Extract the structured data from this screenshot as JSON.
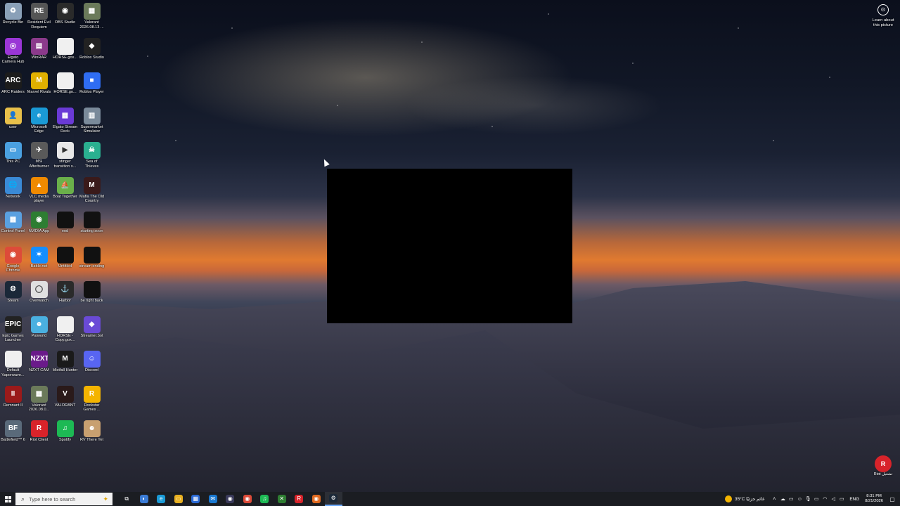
{
  "desktop": {
    "icons": [
      {
        "label": "Recycle Bin",
        "icon": "recycle-bin-icon",
        "color": "#8aa0b8",
        "glyph": "♻"
      },
      {
        "label": "Resident Evil Requiem",
        "icon": "resident-evil-icon",
        "color": "#555555",
        "glyph": "RE"
      },
      {
        "label": "OBS Studio",
        "icon": "obs-studio-icon",
        "color": "#2a2a2a",
        "glyph": "◉"
      },
      {
        "label": "Valorant 2026.08.13 ...",
        "icon": "valorant-clip-icon",
        "color": "#6b7a5a",
        "glyph": "▦"
      },
      {
        "label": "Elgato Camera Hub",
        "icon": "elgato-camera-hub-icon",
        "color": "#9a36d6",
        "glyph": "◎"
      },
      {
        "label": "WinRAR",
        "icon": "winrar-icon",
        "color": "#8b3a8b",
        "glyph": "▤"
      },
      {
        "label": "HORSE.gox...",
        "icon": "file-icon",
        "color": "#f0f0f0",
        "glyph": ""
      },
      {
        "label": "Roblox Studio",
        "icon": "roblox-studio-icon",
        "color": "#222222",
        "glyph": "◆"
      },
      {
        "label": "ARC Raiders",
        "icon": "arc-raiders-icon",
        "color": "#1c1c1c",
        "glyph": "ARC"
      },
      {
        "label": "Marvel Rivals",
        "icon": "marvel-rivals-icon",
        "color": "#e0b000",
        "glyph": "M"
      },
      {
        "label": "HORSE.go...",
        "icon": "file-icon",
        "color": "#f0f0f0",
        "glyph": ""
      },
      {
        "label": "Roblox Player",
        "icon": "roblox-player-icon",
        "color": "#2f6df2",
        "glyph": "■"
      },
      {
        "label": "user",
        "icon": "user-folder-icon",
        "color": "#e8c04a",
        "glyph": "👤"
      },
      {
        "label": "Microsoft Edge",
        "icon": "microsoft-edge-icon",
        "color": "#1a9ad6",
        "glyph": "e"
      },
      {
        "label": "Elgato Stream Deck",
        "icon": "elgato-stream-deck-icon",
        "color": "#6a3ad6",
        "glyph": "▦"
      },
      {
        "label": "Supermarket Simulator",
        "icon": "supermarket-simulator-icon",
        "color": "#7a8a9a",
        "glyph": "▥"
      },
      {
        "label": "This PC",
        "icon": "this-pc-icon",
        "color": "#4aa0e0",
        "glyph": "▭"
      },
      {
        "label": "MSI Afterburner",
        "icon": "msi-afterburner-icon",
        "color": "#5a5a5a",
        "glyph": "✈"
      },
      {
        "label": "stinger transition s...",
        "icon": "file-icon",
        "color": "#e8e8e8",
        "glyph": "▶"
      },
      {
        "label": "Sea of Thieves",
        "icon": "sea-of-thieves-icon",
        "color": "#2ab090",
        "glyph": "☠"
      },
      {
        "label": "Network",
        "icon": "network-icon",
        "color": "#3a8ad6",
        "glyph": "🌐"
      },
      {
        "label": "VLC media player",
        "icon": "vlc-icon",
        "color": "#f08a00",
        "glyph": "▲"
      },
      {
        "label": "Boat Together",
        "icon": "boat-together-icon",
        "color": "#6ab04a",
        "glyph": "⛵"
      },
      {
        "label": "Mafia The Old Country",
        "icon": "mafia-icon",
        "color": "#3a1a1a",
        "glyph": "M"
      },
      {
        "label": "Control Panel",
        "icon": "control-panel-icon",
        "color": "#5aa0e0",
        "glyph": "▦"
      },
      {
        "label": "NVIDIA App",
        "icon": "nvidia-app-icon",
        "color": "#2e7d32",
        "glyph": "◉"
      },
      {
        "label": "end",
        "icon": "video-file-icon",
        "color": "#111111",
        "glyph": ""
      },
      {
        "label": "starting soon",
        "icon": "video-file-icon",
        "color": "#111111",
        "glyph": ""
      },
      {
        "label": "Google Chrome",
        "icon": "google-chrome-icon",
        "color": "#dd4b39",
        "glyph": "◉"
      },
      {
        "label": "Battle.net",
        "icon": "battle-net-icon",
        "color": "#148eff",
        "glyph": "✶"
      },
      {
        "label": "Untitled",
        "icon": "video-file-icon",
        "color": "#111111",
        "glyph": ""
      },
      {
        "label": "stream ending",
        "icon": "video-file-icon",
        "color": "#111111",
        "glyph": ""
      },
      {
        "label": "Steam",
        "icon": "steam-icon",
        "color": "#1b2838",
        "glyph": "⚙"
      },
      {
        "label": "Overwatch",
        "icon": "overwatch-icon",
        "color": "#e0e0e0",
        "glyph": "◯"
      },
      {
        "label": "Harbor",
        "icon": "harbor-icon",
        "color": "#2a2a2a",
        "glyph": "⚓"
      },
      {
        "label": "be right back",
        "icon": "video-file-icon",
        "color": "#111111",
        "glyph": ""
      },
      {
        "label": "Epic Games Launcher",
        "icon": "epic-games-icon",
        "color": "#222222",
        "glyph": "EPIC"
      },
      {
        "label": "Palworld",
        "icon": "palworld-icon",
        "color": "#4ab0e0",
        "glyph": "☻"
      },
      {
        "label": "HORSE - Copy.gox...",
        "icon": "file-icon",
        "color": "#f0f0f0",
        "glyph": ""
      },
      {
        "label": "Streamer.bot",
        "icon": "streamer-bot-icon",
        "color": "#6a4ad6",
        "glyph": "◆"
      },
      {
        "label": "Default Vaporwave...",
        "icon": "file-icon",
        "color": "#f0f0f0",
        "glyph": ""
      },
      {
        "label": "NZXT CAM",
        "icon": "nzxt-cam-icon",
        "color": "#6a1a8a",
        "glyph": "NZXT"
      },
      {
        "label": "Mistfall Hunter",
        "icon": "mistfall-hunter-icon",
        "color": "#1a1a1a",
        "glyph": "M"
      },
      {
        "label": "Discord",
        "icon": "discord-icon",
        "color": "#5865f2",
        "glyph": "☺"
      },
      {
        "label": "Remnant II",
        "icon": "remnant-ii-icon",
        "color": "#9a1a1a",
        "glyph": "II"
      },
      {
        "label": "Valorant 2026.08.0...",
        "icon": "valorant-clip-icon",
        "color": "#6b7a5a",
        "glyph": "▦"
      },
      {
        "label": "VALORANT",
        "icon": "valorant-icon",
        "color": "#2a1a1a",
        "glyph": "V"
      },
      {
        "label": "Rockstar Games ...",
        "icon": "rockstar-games-icon",
        "color": "#f4b400",
        "glyph": "R"
      },
      {
        "label": "Battlefield™ 6",
        "icon": "battlefield-6-icon",
        "color": "#5a6a7a",
        "glyph": "BF"
      },
      {
        "label": "Riot Client",
        "icon": "riot-client-icon",
        "color": "#d8232a",
        "glyph": "R"
      },
      {
        "label": "Spotify",
        "icon": "spotify-icon",
        "color": "#1db954",
        "glyph": "♫"
      },
      {
        "label": "RV There Yet",
        "icon": "rv-there-yet-icon",
        "color": "#c8a070",
        "glyph": "☻"
      }
    ],
    "learn_about_picture": "Learn about this picture",
    "riot_shortcut": {
      "label": "Riot تشغيل",
      "glyph": "R"
    }
  },
  "taskbar": {
    "search_placeholder": "Type here to search",
    "apps": [
      {
        "name": "task-view",
        "icon": "task-view-icon",
        "glyph": "⧉",
        "color": "transparent"
      },
      {
        "name": "copilot",
        "icon": "copilot-icon",
        "glyph": "◐",
        "color": "#3a7bd5"
      },
      {
        "name": "edge",
        "icon": "microsoft-edge-icon",
        "glyph": "e",
        "color": "#1a9ad6"
      },
      {
        "name": "file-explorer",
        "icon": "file-explorer-icon",
        "glyph": "▭",
        "color": "#e8b020"
      },
      {
        "name": "store",
        "icon": "microsoft-store-icon",
        "glyph": "▦",
        "color": "#2a6ad6"
      },
      {
        "name": "mail",
        "icon": "mail-icon",
        "glyph": "✉",
        "color": "#1a78d0"
      },
      {
        "name": "obs",
        "icon": "obs-studio-icon",
        "glyph": "◉",
        "color": "#3a3a5a"
      },
      {
        "name": "chrome",
        "icon": "google-chrome-icon",
        "glyph": "◉",
        "color": "#dd4b39"
      },
      {
        "name": "spotify",
        "icon": "spotify-icon",
        "glyph": "♫",
        "color": "#1db954"
      },
      {
        "name": "xbox",
        "icon": "xbox-icon",
        "glyph": "✕",
        "color": "#2e7d32"
      },
      {
        "name": "riot",
        "icon": "riot-client-icon",
        "glyph": "R",
        "color": "#d8232a"
      },
      {
        "name": "chrome-2",
        "icon": "chrome-canary-icon",
        "glyph": "◉",
        "color": "#e06a20"
      },
      {
        "name": "steam",
        "icon": "steam-icon",
        "glyph": "⚙",
        "color": "#1b2838"
      }
    ],
    "weather": "35°C غائم جزئيًا",
    "language": "ENG",
    "time": "8:31 PM",
    "date": "8/21/2026"
  }
}
